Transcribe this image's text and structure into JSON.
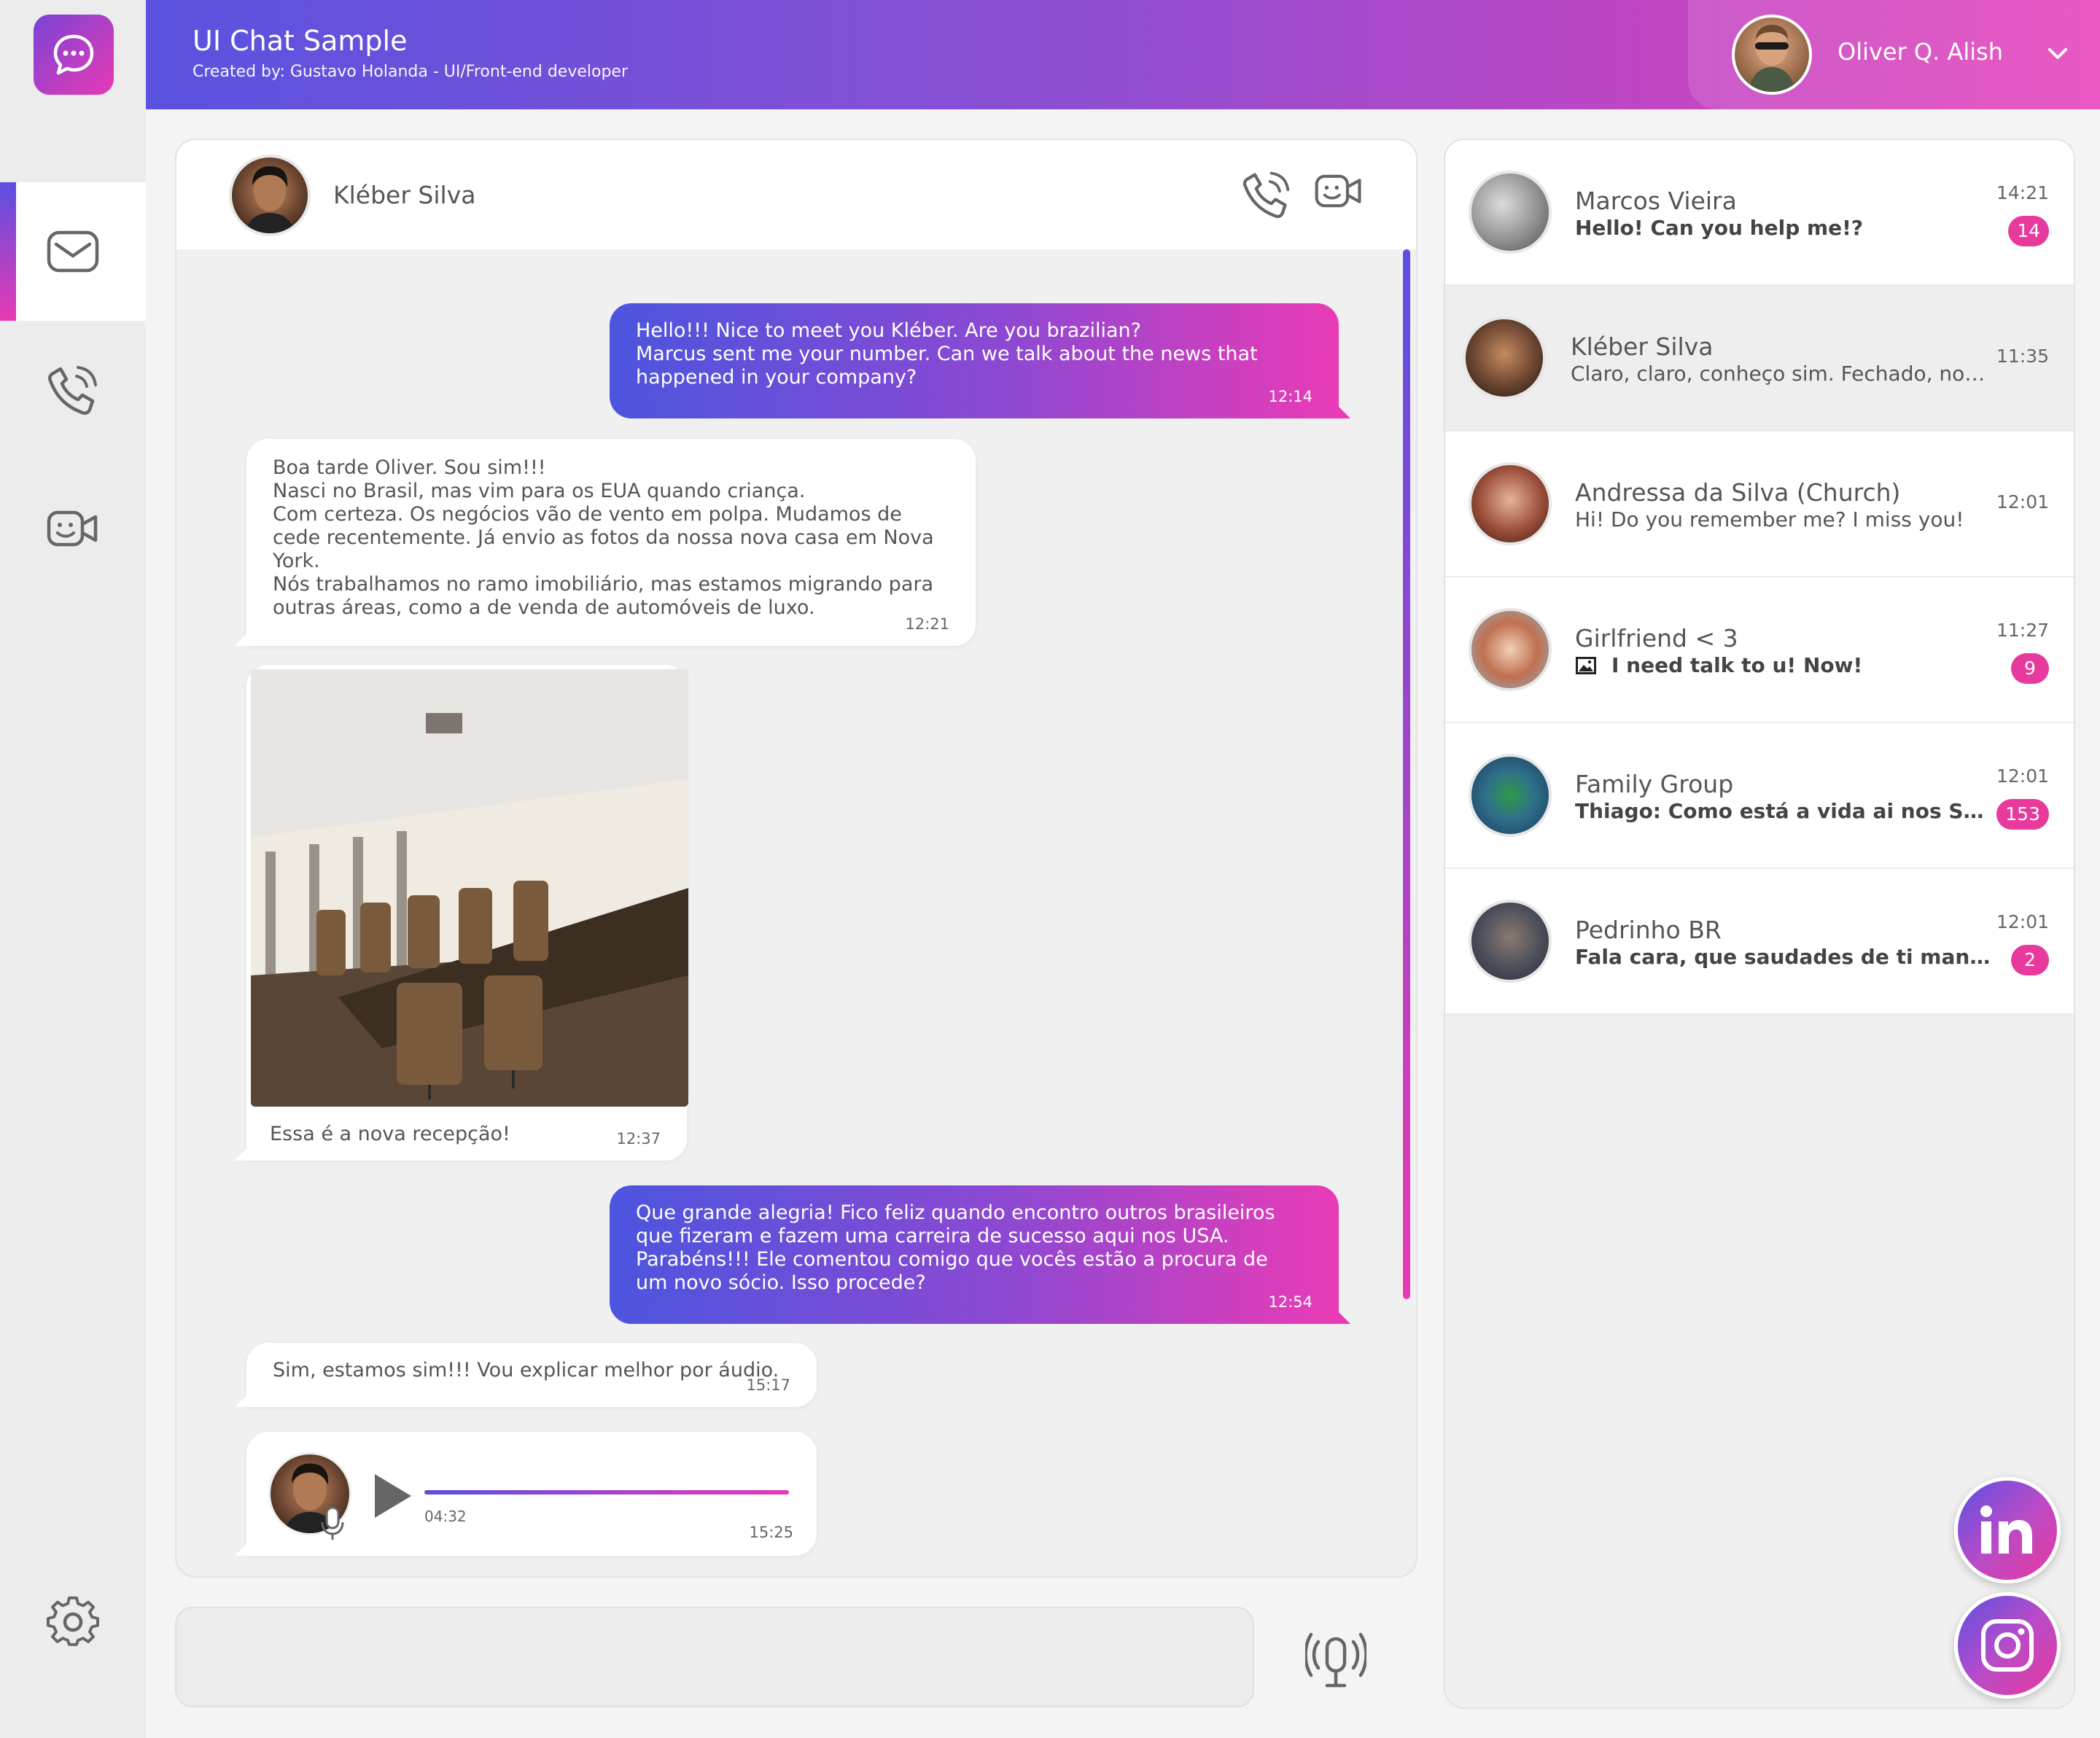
{
  "app": {
    "title": "UI Chat Sample",
    "credit": "Created by: Gustavo Holanda - UI/Front-end developer"
  },
  "user": {
    "name": "Oliver Q. Alish"
  },
  "sidebar": {
    "items": [
      {
        "icon": "mail-icon",
        "active": true
      },
      {
        "icon": "phone-icon",
        "active": false
      },
      {
        "icon": "video-icon",
        "active": false
      },
      {
        "icon": "gear-icon",
        "active": false
      }
    ]
  },
  "chat": {
    "contact_name": "Kléber Silva",
    "messages": [
      {
        "direction": "out",
        "lines": [
          "Hello!!! Nice to meet you Kléber. Are you brazilian?",
          "Marcus sent me your number. Can we talk about the news that",
          "happened in your company?"
        ],
        "time": "12:14"
      },
      {
        "direction": "in",
        "lines": [
          "Boa tarde Oliver. Sou sim!!!",
          "Nasci no Brasil, mas vim para os EUA quando criança.",
          "Com certeza. Os negócios vão de vento em polpa. Mudamos de",
          "cede recentemente. Já envio as fotos da nossa nova casa em Nova",
          "York.",
          "Nós trabalhamos no ramo imobiliário, mas estamos migrando para",
          "outras áreas, como a de venda de automóveis de luxo."
        ],
        "time": "12:21"
      },
      {
        "direction": "in",
        "type": "image",
        "caption": "Essa é a nova recepção!",
        "time": "12:37"
      },
      {
        "direction": "out",
        "lines": [
          "Que grande alegria! Fico feliz quando encontro outros brasileiros",
          "que fizeram e fazem uma carreira de sucesso aqui nos USA.",
          "Parabéns!!! Ele comentou comigo que vocês estão a procura de",
          "um novo sócio. Isso procede?"
        ],
        "time": "12:54"
      },
      {
        "direction": "in",
        "lines": [
          "Sim, estamos sim!!! Vou explicar melhor por áudio."
        ],
        "time": "15:17"
      },
      {
        "direction": "in",
        "type": "audio",
        "duration": "04:32",
        "time": "15:25"
      }
    ]
  },
  "composer": {
    "placeholder": ""
  },
  "conversations": [
    {
      "name": "Marcos Vieira",
      "preview": "Hello! Can you help me!?",
      "time": "14:21",
      "unread": "14",
      "bold": true
    },
    {
      "name": "Kléber Silva",
      "preview": "Claro, claro, conheço sim. Fechado, nos encontramos amanhã",
      "time": "11:35",
      "unread": "",
      "bold": false,
      "active": true
    },
    {
      "name": "Andressa da Silva (Church)",
      "preview": "Hi! Do you remember me? I miss you!",
      "time": "12:01",
      "unread": "",
      "bold": false
    },
    {
      "name": "Girlfriend < 3",
      "preview": "I need talk to u! Now!",
      "time": "11:27",
      "unread": "9",
      "bold": true,
      "has_image_icon": true
    },
    {
      "name": "Family Group",
      "preview": "Thiago: Como está a vida ai nos States?",
      "time": "12:01",
      "unread": "153",
      "bold": true
    },
    {
      "name": "Pedrinho BR",
      "preview": "Fala cara, que saudades de ti man! Quando vamos nos ver?",
      "time": "12:01",
      "unread": "2",
      "bold": true
    }
  ],
  "social": [
    {
      "icon": "linkedin-icon"
    },
    {
      "icon": "instagram-icon"
    }
  ],
  "colors": {
    "gradient_start": "#5a52df",
    "gradient_end": "#e83ab4",
    "badge": "#e8399d"
  }
}
